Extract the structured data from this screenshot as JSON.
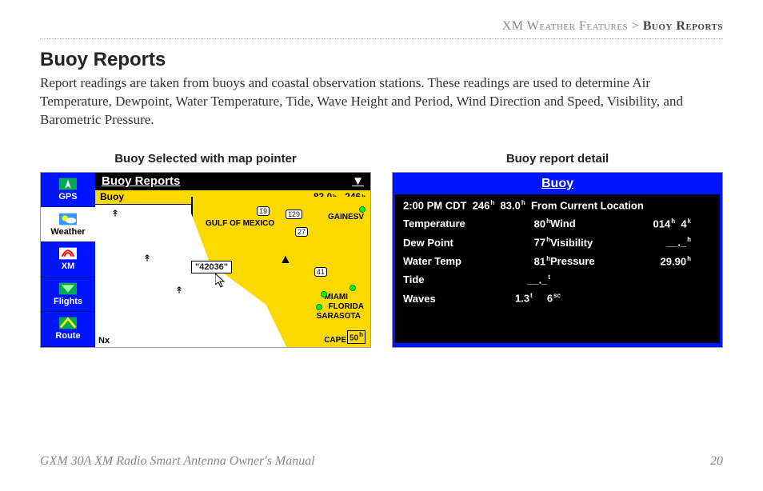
{
  "breadcrumb": {
    "section": "XM Weather Features",
    "sep": " > ",
    "page": "Buoy Reports"
  },
  "heading": "Buoy Reports",
  "body_text": "Report readings are taken from buoys and coastal observation stations. These readings are used to determine Air Temperature, Dewpoint, Water Temperature, Tide, Wave Height and Period, Wind Direction and Speed, Visibility, and Barometric Pressure.",
  "panel_left_caption": "Buoy Selected with map pointer",
  "panel_right_caption": "Buoy report detail",
  "sidebar": {
    "items": [
      {
        "label": "GPS"
      },
      {
        "label": "Weather"
      },
      {
        "label": "XM"
      },
      {
        "label": "Flights"
      },
      {
        "label": "Route"
      }
    ]
  },
  "map_screen": {
    "title": "Buoy Reports",
    "status_label": "Buoy",
    "status_temp": "83.0",
    "status_temp_unit": "h",
    "status_bearing": "246",
    "status_bearing_unit": "h",
    "pointer_id": "\"42036\"",
    "labels": {
      "gulf": "GULF OF MEXICO",
      "gainesv": "GAINESV",
      "miami": "MIAMI",
      "florida": "FLORIDA",
      "sarasota": "SARASOTA",
      "cape": "CAPE",
      "r19": "19",
      "r129": "129",
      "r27": "27",
      "r41": "41"
    },
    "scale": "50",
    "scale_unit": "h",
    "corner": "Nx"
  },
  "detail": {
    "title": "Buoy",
    "header_time": "2:00 PM CDT",
    "header_bearing": "246",
    "header_bearing_unit": "h",
    "header_temp": "83.0",
    "header_temp_unit": "h",
    "header_from": "From Current Location",
    "rows": {
      "temperature_label": "Temperature",
      "temperature_value": "80",
      "temperature_unit": "h",
      "wind_label": "Wind",
      "wind_dir": "014",
      "wind_dir_unit": "h",
      "wind_speed": "4",
      "wind_speed_unit": "k",
      "dewpoint_label": "Dew Point",
      "dewpoint_value": "77",
      "dewpoint_unit": "h",
      "visibility_label": "Visibility",
      "visibility_value": "__._",
      "visibility_unit": "h",
      "watertemp_label": "Water Temp",
      "watertemp_value": "81",
      "watertemp_unit": "h",
      "pressure_label": "Pressure",
      "pressure_value": "29.90",
      "pressure_unit": "h",
      "tide_label": "Tide",
      "tide_value": "__._",
      "tide_unit": "t",
      "waves_label": "Waves",
      "waves_height": "1.3",
      "waves_height_unit": "t",
      "waves_period": "6",
      "waves_period_unit": "sc"
    }
  },
  "footer": {
    "manual": "GXM 30A XM Radio Smart Antenna Owner's Manual",
    "page_no": "20"
  }
}
